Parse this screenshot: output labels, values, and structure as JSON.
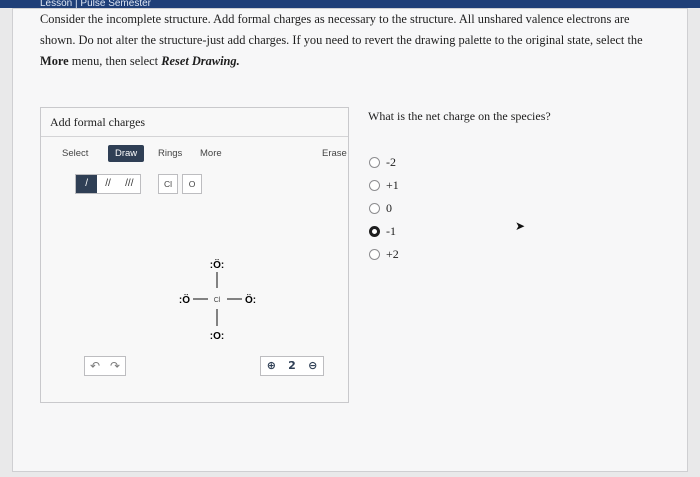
{
  "header": {
    "tab_text": "Lesson | Pulse Semester"
  },
  "question": {
    "line1": "Consider the incomplete structure. Add formal charges as necessary to the structure. All unshared valence electrons are",
    "line2": "shown. Do not alter the structure-just add charges. If you need to revert the drawing palette to the original state, select the",
    "line3_bold": "More",
    "line3_rest": " menu, then select ",
    "line3_italic": "Reset Drawing."
  },
  "panel": {
    "title": "Add formal charges",
    "toolbar": {
      "select": "Select",
      "draw": "Draw",
      "rings": "Rings",
      "more": "More",
      "erase": "Erase"
    },
    "bonds": [
      "/",
      "//",
      "///"
    ],
    "atoms": [
      "Cl",
      "O"
    ],
    "molecule": {
      "center": "Cl",
      "top": ":Ö:",
      "bottom": ":O:",
      "left": ":Ö",
      "right": "Ö:"
    },
    "undo_icon": "undo-icon",
    "redo_icon": "redo-icon",
    "zoom_icons": [
      "zoom-in-icon",
      "reset-zoom-icon",
      "zoom-out-icon"
    ]
  },
  "charge_question": {
    "prompt": "What is the net charge on the species?",
    "options": [
      "-2",
      "+1",
      "0",
      "-1",
      "+2"
    ],
    "selected": "-1"
  }
}
